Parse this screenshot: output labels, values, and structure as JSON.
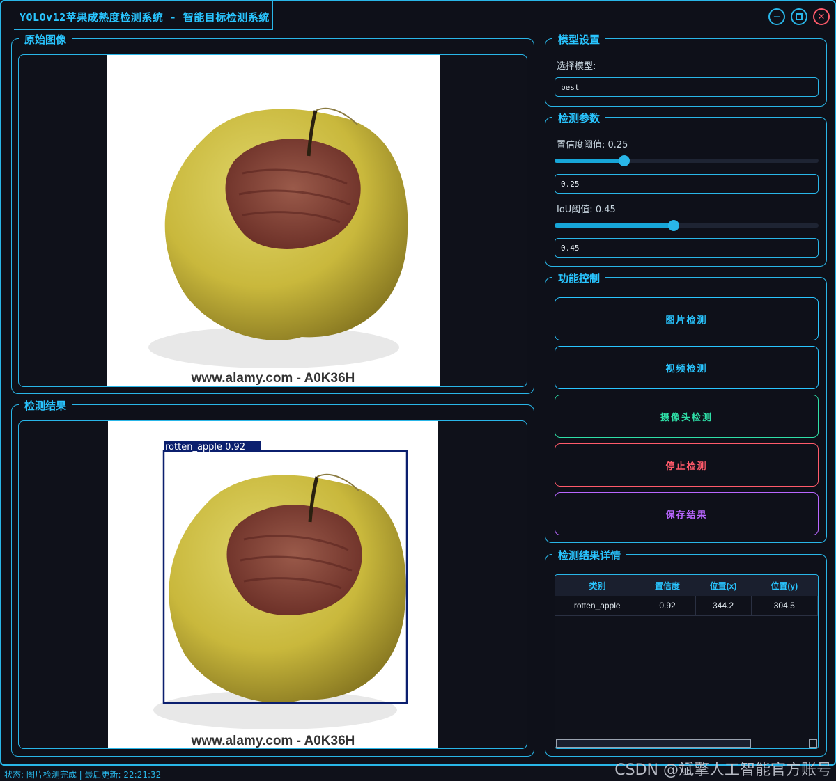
{
  "window": {
    "title": "YOLOv12苹果成熟度检测系统 - 智能目标检测系统",
    "minimize_icon": "minimize-icon",
    "maximize_icon": "maximize-icon",
    "close_icon": "close-icon"
  },
  "original_panel": {
    "title": "原始图像",
    "watermark": "www.alamy.com - A0K36H"
  },
  "result_panel": {
    "title": "检测结果",
    "detection_label": "rotten_apple  0.92",
    "watermark": "www.alamy.com - A0K36H"
  },
  "model_settings": {
    "title": "模型设置",
    "select_label": "选择模型:",
    "selected_model": "best"
  },
  "detection_params": {
    "title": "检测参数",
    "confidence_label": "置信度阈值: 0.25",
    "confidence_value": "0.25",
    "confidence_level": 0.25,
    "iou_label": "IoU阈值: 0.45",
    "iou_value": "0.45",
    "iou_level": 0.45
  },
  "function_control": {
    "title": "功能控制",
    "buttons": [
      "图片检测",
      "视频检测",
      "摄像头检测",
      "停止检测",
      "保存结果"
    ],
    "colors": [
      "#29c5ff",
      "#29c5ff",
      "#2fe0a8",
      "#ff5a6a",
      "#b866ff"
    ]
  },
  "results_detail": {
    "title": "检测结果详情",
    "columns": [
      "类别",
      "置信度",
      "位置(x)",
      "位置(y)"
    ],
    "rows": [
      [
        "rotten_apple",
        "0.92",
        "344.2",
        "304.5"
      ]
    ]
  },
  "status_bar": {
    "text": "状态: 图片检测完成 | 最后更新: 22:21:32"
  },
  "watermark_overlay": "CSDN @斌擎人工智能官方账号",
  "colors": {
    "accent": "#29b6e8",
    "background": "#0e1019"
  }
}
